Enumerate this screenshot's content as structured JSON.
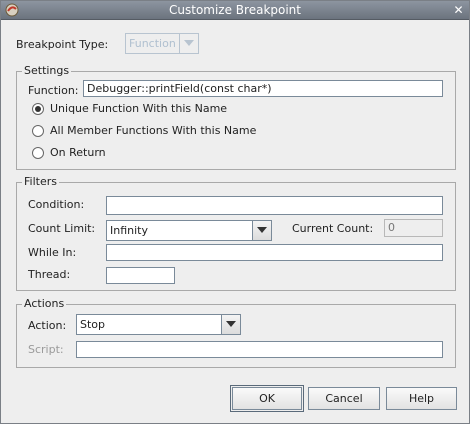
{
  "window": {
    "title": "Customize Breakpoint"
  },
  "breakpoint_type": {
    "label": "Breakpoint Type:",
    "value": "Function"
  },
  "settings": {
    "title": "Settings",
    "function_label": "Function:",
    "function_value": "Debugger::printField(const char*)",
    "radios": [
      {
        "label": "Unique Function With this Name",
        "checked": true
      },
      {
        "label": "All Member Functions With this Name",
        "checked": false
      },
      {
        "label": "On Return",
        "checked": false
      }
    ]
  },
  "filters": {
    "title": "Filters",
    "condition_label": "Condition:",
    "condition_value": "",
    "count_limit_label": "Count Limit:",
    "count_limit_value": "Infinity",
    "current_count_label": "Current Count:",
    "current_count_value": "0",
    "while_in_label": "While In:",
    "while_in_value": "",
    "thread_label": "Thread:",
    "thread_value": ""
  },
  "actions": {
    "title": "Actions",
    "action_label": "Action:",
    "action_value": "Stop",
    "script_label": "Script:",
    "script_value": ""
  },
  "buttons": {
    "ok": "OK",
    "cancel": "Cancel",
    "help": "Help"
  }
}
